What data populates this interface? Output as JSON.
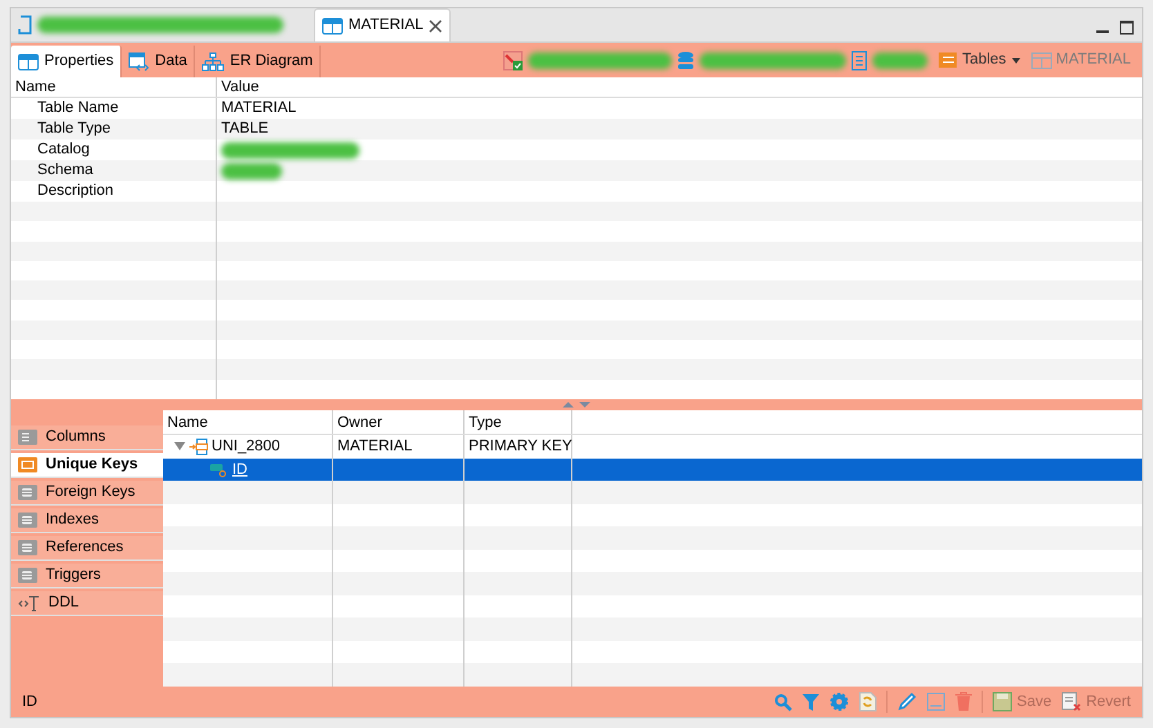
{
  "editor_tabs": [
    {
      "kind": "redacted",
      "selected": false
    },
    {
      "kind": "named",
      "label": "MATERIAL",
      "selected": true
    }
  ],
  "view_tabs": [
    {
      "label": "Properties",
      "kind": "table",
      "selected": true
    },
    {
      "label": "Data",
      "kind": "data",
      "selected": false
    },
    {
      "label": "ER Diagram",
      "kind": "diagram",
      "selected": false
    }
  ],
  "toolbar": {
    "tables_menu": "Tables",
    "object_button": {
      "label": "MATERIAL",
      "disabled": true
    }
  },
  "properties": {
    "columns": [
      "Name",
      "Value"
    ],
    "rows": [
      {
        "name": "Table Name",
        "value": "MATERIAL"
      },
      {
        "name": "Table Type",
        "value": "TABLE"
      },
      {
        "name": "Catalog",
        "redacted": true
      },
      {
        "name": "Schema",
        "redacted": true
      },
      {
        "name": "Description"
      }
    ]
  },
  "side_tabs": [
    {
      "label": "Columns",
      "kind": "columns",
      "selected": false
    },
    {
      "label": "Unique Keys",
      "kind": "key",
      "selected": true
    },
    {
      "label": "Foreign Keys",
      "kind": "stack",
      "selected": false
    },
    {
      "label": "Indexes",
      "kind": "stack",
      "selected": false
    },
    {
      "label": "References",
      "kind": "stack",
      "selected": false
    },
    {
      "label": "Triggers",
      "kind": "stack",
      "selected": false
    },
    {
      "label": "DDL",
      "kind": "ddl",
      "selected": false
    }
  ],
  "keys_table": {
    "columns": [
      "Name",
      "Owner",
      "Type"
    ],
    "rows": [
      {
        "name": "UNI_2800",
        "owner": "MATERIAL",
        "type": "PRIMARY KEY",
        "expanded": true,
        "selected": false,
        "children": [
          {
            "name": "ID",
            "selected": true
          }
        ]
      }
    ]
  },
  "status_bar": {
    "text": "ID",
    "buttons": [
      {
        "label": "Save",
        "disabled": true
      },
      {
        "label": "Revert",
        "disabled": true
      }
    ]
  }
}
